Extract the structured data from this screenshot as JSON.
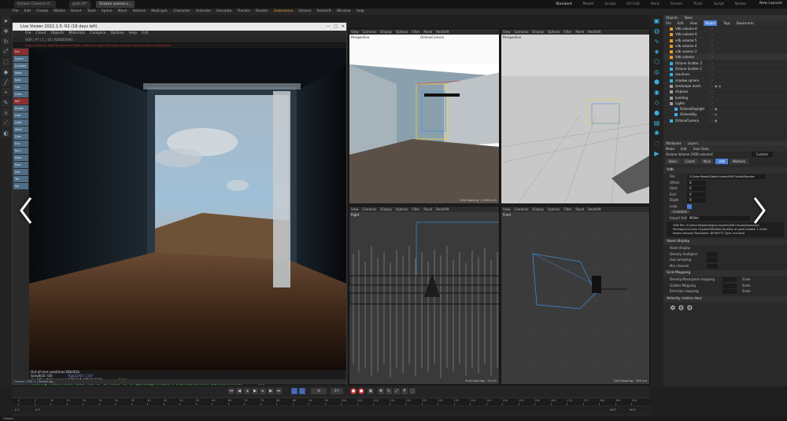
{
  "tabs": [
    {
      "label": "Octane Camera.rt...",
      "active": false
    },
    {
      "label": "grds.rtt*",
      "active": false
    },
    {
      "label": "Octane scenes.c...",
      "active": true
    }
  ],
  "menubar": [
    "File",
    "Edit",
    "Create",
    "Modes",
    "Select",
    "Tools",
    "Spline",
    "Mesh",
    "Volume",
    "MoGraph",
    "Character",
    "Animate",
    "Simulate",
    "Tracker",
    "Render",
    "Extensions",
    "Octane",
    "Redshift",
    "Window",
    "Help"
  ],
  "layouts": [
    {
      "label": "Standard",
      "active": true
    },
    {
      "label": "Model",
      "active": false
    },
    {
      "label": "Sculpt",
      "active": false
    },
    {
      "label": "UV Edit",
      "active": false
    },
    {
      "label": "Paint",
      "active": false
    },
    {
      "label": "Groom",
      "active": false
    },
    {
      "label": "Track",
      "active": false
    },
    {
      "label": "Script",
      "active": false
    },
    {
      "label": "Nodes",
      "active": false
    }
  ],
  "new_layout": "New Layouts",
  "render_window": {
    "title": "Live Viewer 2022.1.5- R2 (16 days left)",
    "menu": [
      "File",
      "Cloud",
      "Objects",
      "Materials",
      "Compare",
      "Options",
      "Help",
      "GUI"
    ],
    "toolbar": "HDR  | PT  | 1  | 16  | RENDERING",
    "error": "Error: Could not load the selected frame, please try again and make sure you have an active subscription",
    "side_items": [
      {
        "label": "Pre",
        "red": true
      },
      {
        "label": "Scene",
        "red": false
      },
      {
        "label": "Compile",
        "red": false
      },
      {
        "label": "Mate",
        "red": false
      },
      {
        "label": "Sele",
        "red": false
      },
      {
        "label": "Opt",
        "red": false
      },
      {
        "label": "Gizm",
        "red": false
      },
      {
        "label": "Ref",
        "red": true
      },
      {
        "label": "Image",
        "red": false
      },
      {
        "label": "Calc",
        "red": false
      },
      {
        "label": "Light",
        "red": false
      },
      {
        "label": "Mesh",
        "red": false
      },
      {
        "label": "Cam",
        "red": false
      },
      {
        "label": "Env",
        "red": false
      },
      {
        "label": "Kern",
        "red": false
      },
      {
        "label": "Mate",
        "red": false
      },
      {
        "label": "Post",
        "red": false
      },
      {
        "label": "Info",
        "red": false
      },
      {
        "label": "Tex",
        "red": false
      },
      {
        "label": "Vol",
        "red": false
      }
    ],
    "stats": [
      {
        "label": "Out-of-core used/max:0Kb/4Gb",
        "value": ""
      },
      {
        "label": "Grey8/16: 0/0",
        "value": "Rgb32/64: 11/0"
      },
      {
        "label": "Used/free/total vram: 2.679Gb/5.075Gb/11Gb",
        "value": "Color"
      },
      {
        "label": "Rendering: 3.586%  Ms/sec: 92.827  Time: 00 : 00 : 49/00 : 11 : 09  Spp/maxspp: 57/1200  Tri: 2.389m/12.6m  Mesh: 1024  Hair: 0  RTX:on",
        "value": "GPU"
      }
    ],
    "status": "Octane  |  GPU: 1  |  Rendering ..."
  },
  "viewports": [
    {
      "name": "Perspective",
      "camera": "OctaneCamera",
      "footer": "Grid Spacing : 10000 cm",
      "menu": [
        "View",
        "Cameras",
        "Display",
        "Options",
        "Filter",
        "Panel",
        "Redshift"
      ]
    },
    {
      "name": "Perspective",
      "camera": "",
      "footer": "",
      "menu": [
        "View",
        "Cameras",
        "Display",
        "Options",
        "Filter",
        "Panel",
        "Redshift"
      ]
    },
    {
      "name": "Right",
      "camera": "",
      "footer": "Grid Spacing : 10 cm",
      "menu": [
        "View",
        "Cameras",
        "Display",
        "Options",
        "Filter",
        "Panel",
        "Redshift"
      ]
    },
    {
      "name": "Front",
      "camera": "",
      "footer": "Grid Spacing : 100 cm",
      "menu": [
        "View",
        "Cameras",
        "Display",
        "Options",
        "Filter",
        "Panel",
        "Redshift"
      ]
    }
  ],
  "objects_panel": {
    "tabs": [
      "Objects",
      "Takes"
    ],
    "menu": [
      "File",
      "Edit",
      "View",
      "Object",
      "Tags",
      "Bookmarks"
    ],
    "items": [
      "Vdb volume 8",
      "Vdb volume 6",
      "vdb volume 5",
      "vdb volume 4",
      "vdb volume 3",
      "Vdb volume",
      "Octane Scatter 3",
      "Octane Scatter 2",
      "reactions",
      "shadow sphere",
      "landscape mesh",
      "displace",
      "building",
      "Lights",
      "OctaneDaylight",
      "OctaneSky",
      "OctaneCamera"
    ]
  },
  "attributes_panel": {
    "tabs_top": [
      "Attributes",
      "Layers"
    ],
    "menu": [
      "Mode",
      "Edit",
      "User Data"
    ],
    "object_label": "Octane Volume [VDB volume]",
    "custom": "Custom",
    "tabs": [
      {
        "label": "Basic",
        "active": false
      },
      {
        "label": "Coord.",
        "active": false
      },
      {
        "label": "Main",
        "active": false
      },
      {
        "label": "Vdb",
        "active": true
      },
      {
        "label": "Medium",
        "active": false
      }
    ],
    "section": "Vdb",
    "fields": [
      {
        "label": "File",
        "value": "G:\\Zeba Mybaki\\Digital Assets\\VDB Clouds\\Downloa"
      },
      {
        "label": "Offset",
        "value": "0"
      },
      {
        "label": "Start",
        "value": "0"
      },
      {
        "label": "End",
        "value": "0"
      },
      {
        "label": "Digits",
        "value": "0"
      },
      {
        "label": "Loop",
        "value": ""
      },
      {
        "label": "Loadable",
        "value": ""
      },
      {
        "label": "Import Unit",
        "value": "Millim"
      }
    ],
    "note": "VDB File: G:\\Zeba Mybaki\\Digital Assets\\VDB Clouds\\Download Package\\Cumulus Clouds\\VDB\\Vdb\\ Number of grids loaded: 1 Grid0: Name=density Resolution: 80*64*71 Type: sca float",
    "sections": [
      "Voxel display",
      "Grid Mapping",
      "Velocity motion blur"
    ],
    "voxel_fields": [
      "Voxel display",
      "Density multiplier",
      "Sub sampling",
      "Min channel"
    ],
    "grid_fields": [
      "Density/Absorption mapping",
      "Scatter Mapping",
      "Emission mapping"
    ],
    "scale_label": "Scale"
  },
  "timeline": {
    "frame": "0 F",
    "ruler_numbers": [
      "0",
      "5",
      "10",
      "15",
      "20",
      "25",
      "30",
      "35",
      "40",
      "45",
      "50",
      "55",
      "60",
      "65",
      "70",
      "75",
      "80",
      "85",
      "90",
      "95",
      "100",
      "105",
      "110",
      "115",
      "120",
      "125",
      "130",
      "135",
      "140",
      "145",
      "150",
      "155",
      "160",
      "165",
      "170",
      "175",
      "180",
      "185",
      "190"
    ],
    "range_start": "0 F",
    "range_end": "90 F",
    "range_end2": "90 F",
    "current": "0 F"
  },
  "bottom_status": "Octane:",
  "colors": {
    "accent": "#4b7fd2",
    "render_button": "#b23232",
    "object_icon": "#e39a2a",
    "side_item": "#4e6d86"
  },
  "icons": [
    "chevron-left-icon",
    "chevron-right-icon",
    "cube-icon",
    "camera-icon",
    "light-icon",
    "move-icon",
    "rotate-icon",
    "scale-icon",
    "play-icon",
    "record-icon"
  ]
}
